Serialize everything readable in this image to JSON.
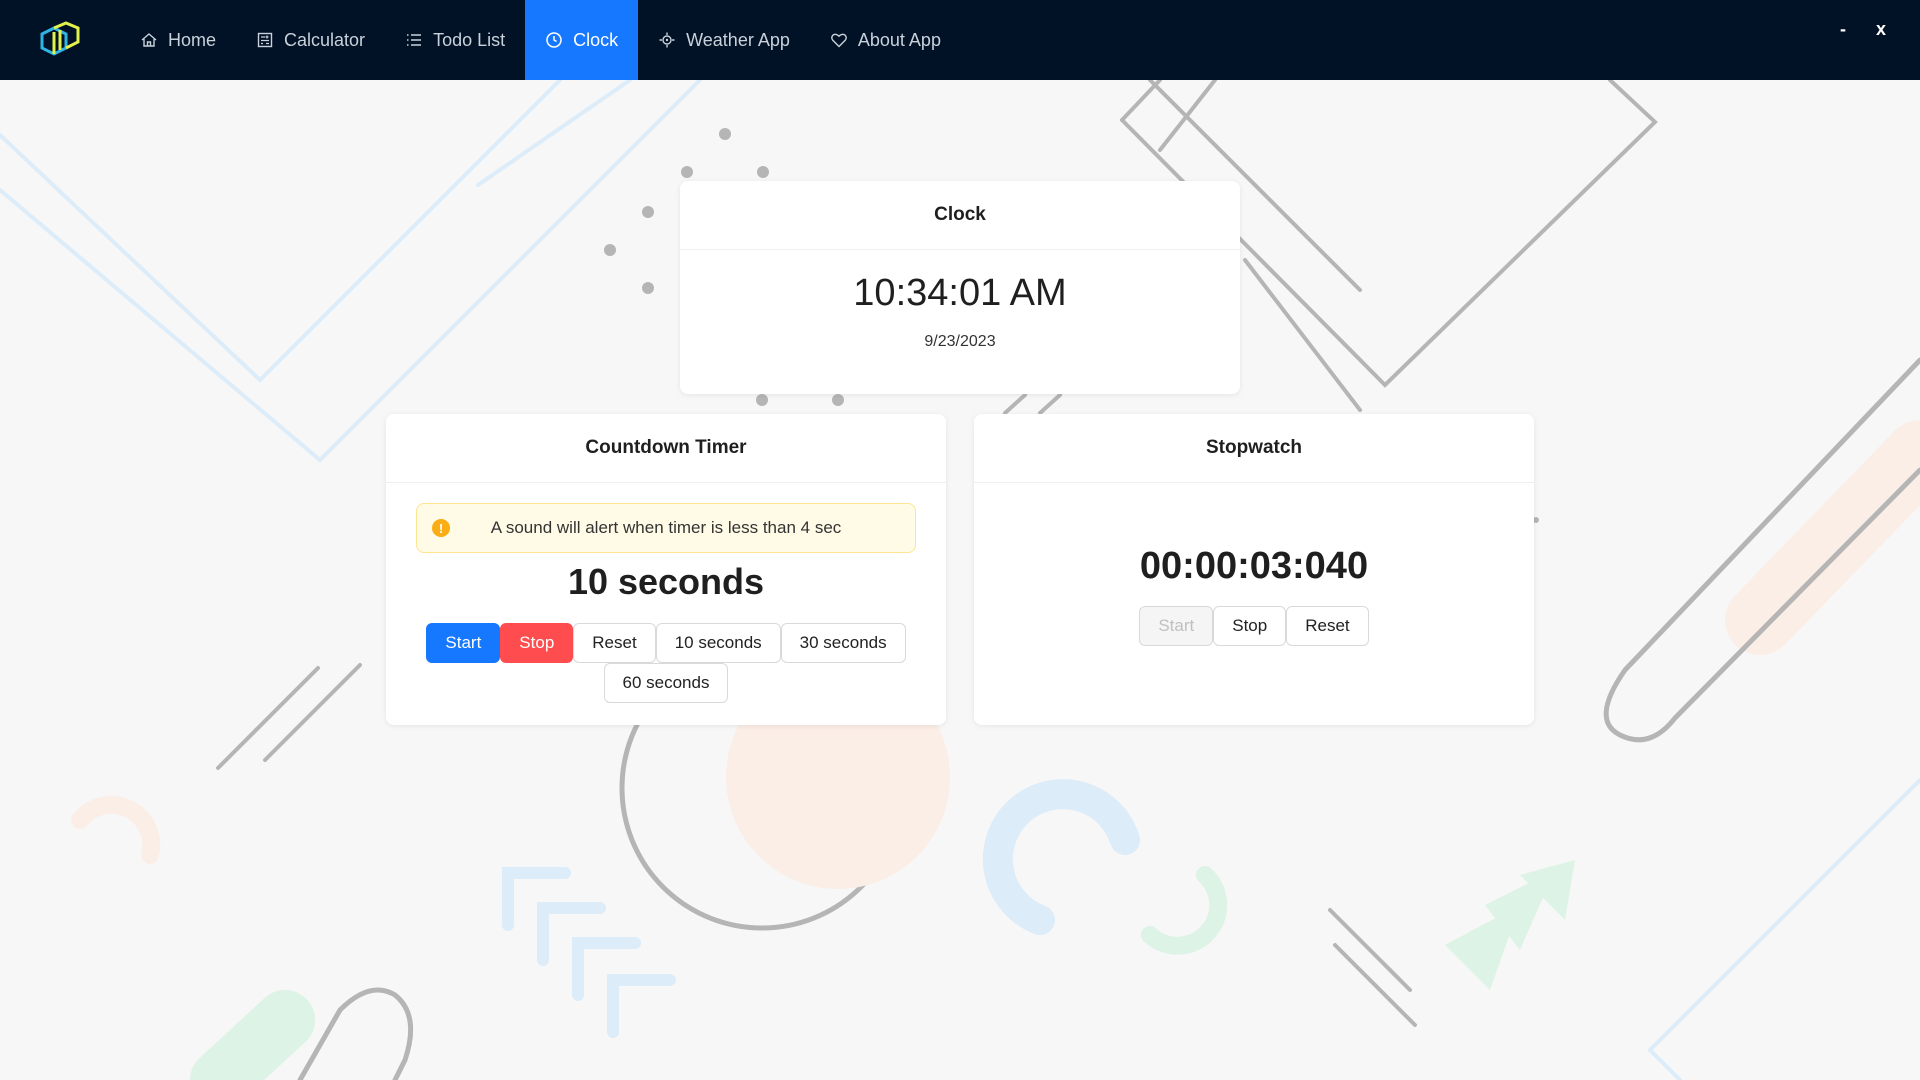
{
  "nav": {
    "items": [
      {
        "label": "Home",
        "icon": "home-icon",
        "active": false
      },
      {
        "label": "Calculator",
        "icon": "calculator-icon",
        "active": false
      },
      {
        "label": "Todo List",
        "icon": "list-icon",
        "active": false
      },
      {
        "label": "Clock",
        "icon": "clock-icon",
        "active": true
      },
      {
        "label": "Weather App",
        "icon": "weather-icon",
        "active": false
      },
      {
        "label": "About App",
        "icon": "heart-icon",
        "active": false
      }
    ],
    "window_controls": {
      "minimize": "-",
      "close": "x"
    }
  },
  "clock": {
    "title": "Clock",
    "time": "10:34:01 AM",
    "date": "9/23/2023"
  },
  "countdown": {
    "title": "Countdown Timer",
    "alert": "A sound will alert when timer is less than 4 sec",
    "value": "10 seconds",
    "buttons": {
      "start": "Start",
      "stop": "Stop",
      "reset": "Reset",
      "preset_10": "10 seconds",
      "preset_30": "30 seconds",
      "preset_60": "60 seconds"
    }
  },
  "stopwatch": {
    "title": "Stopwatch",
    "value": "00:00:03:040",
    "buttons": {
      "start": "Start",
      "stop": "Stop",
      "reset": "Reset"
    }
  },
  "colors": {
    "topbar": "#011226",
    "accent": "#1677ff",
    "danger": "#ff4d4f",
    "warning": "#faad14"
  }
}
